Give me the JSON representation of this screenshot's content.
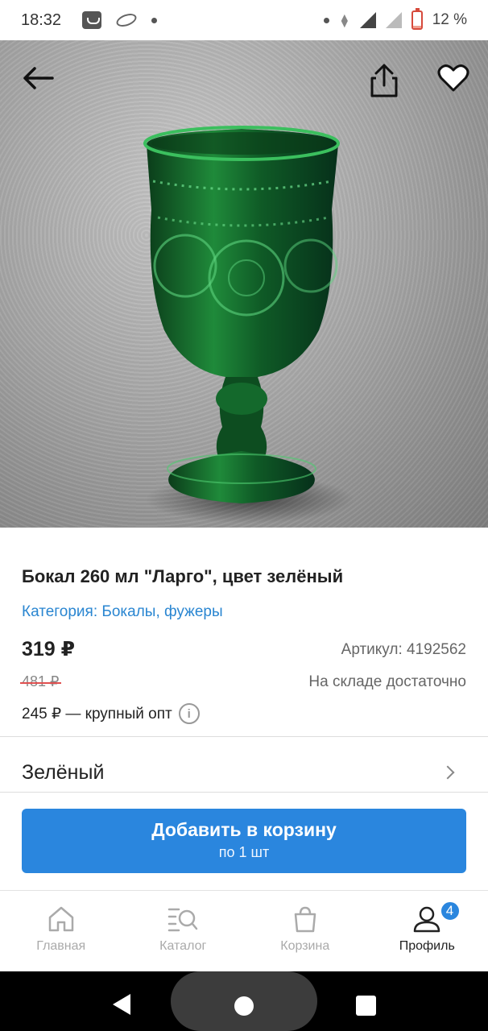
{
  "status_bar": {
    "time": "18:32",
    "battery_text": "12 %",
    "battery_level": 0.12,
    "icons": [
      "notification-box-icon",
      "cloud-icon",
      "dot-icon",
      "data-arrows-icon",
      "signal-icon",
      "signal-empty-icon",
      "battery-icon"
    ]
  },
  "hero": {
    "icons": {
      "back": "arrow-left-icon",
      "share": "share-icon",
      "favorite": "heart-outline-icon"
    }
  },
  "product": {
    "title": "Бокал 260 мл \"Ларго\", цвет зелёный",
    "category": "Категория: Бокалы, фужеры",
    "price": "319 ₽",
    "old_price": "481 ₽",
    "article": "Артикул: 4192562",
    "stock": "На складе достаточно",
    "wholesale": "245 ₽ — крупный опт",
    "wholesale_info_icon": "i"
  },
  "variant": {
    "color": "Зелёный"
  },
  "cart_button": {
    "label": "Добавить в корзину",
    "sublabel": "по 1 шт"
  },
  "bottom_nav": {
    "items": [
      {
        "label": "Главная",
        "icon": "home-icon",
        "active": false
      },
      {
        "label": "Каталог",
        "icon": "catalog-search-icon",
        "active": false
      },
      {
        "label": "Корзина",
        "icon": "shopping-bag-icon",
        "active": false
      },
      {
        "label": "Профиль",
        "icon": "profile-icon",
        "active": true,
        "badge": "4"
      }
    ]
  },
  "colors": {
    "accent": "#2a86de",
    "link": "#2a86d1",
    "strike": "#e05050"
  }
}
